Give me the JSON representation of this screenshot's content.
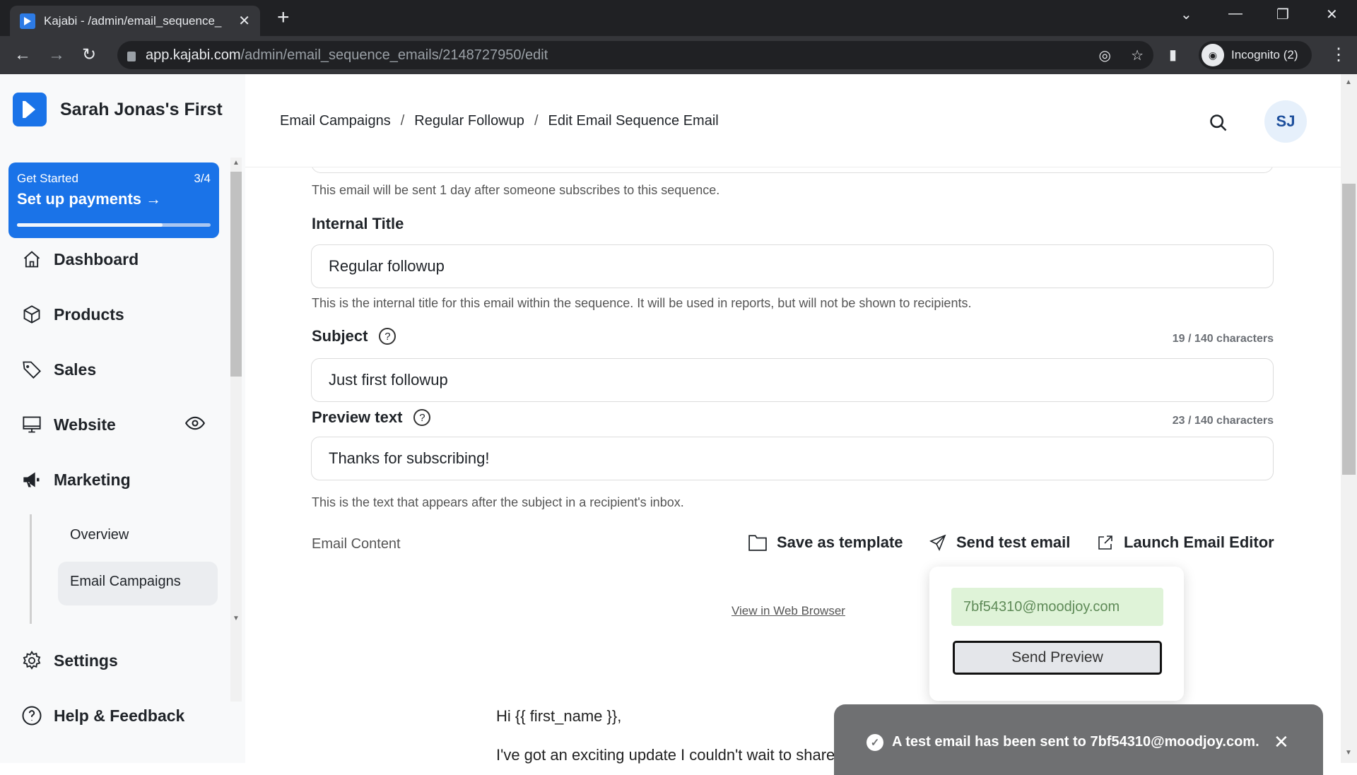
{
  "browser": {
    "tab_title": "Kajabi - /admin/email_sequence_",
    "url_host": "app.kajabi.com",
    "url_path": "/admin/email_sequence_emails/2148727950/edit",
    "profile_label": "Incognito (2)",
    "icons": [
      "back-icon",
      "forward-icon",
      "reload-icon",
      "lock-icon",
      "eye-off-icon",
      "star-icon",
      "sidepanel-icon",
      "incognito-icon",
      "menu-icon"
    ]
  },
  "sidebar": {
    "site_name": "Sarah Jonas's First",
    "get_started": {
      "label": "Get Started",
      "step": "3/4",
      "action": "Set up payments",
      "progress": 0.75
    },
    "items": [
      {
        "label": "Dashboard",
        "icon": "home-icon"
      },
      {
        "label": "Products",
        "icon": "box-icon"
      },
      {
        "label": "Sales",
        "icon": "tag-icon"
      },
      {
        "label": "Website",
        "icon": "monitor-icon"
      },
      {
        "label": "Marketing",
        "icon": "megaphone-icon"
      },
      {
        "label": "Settings",
        "icon": "gear-icon"
      },
      {
        "label": "Help & Feedback",
        "icon": "help-icon"
      }
    ],
    "sub_items": [
      {
        "label": "Overview"
      },
      {
        "label": "Email Campaigns",
        "active": true
      }
    ]
  },
  "header": {
    "breadcrumbs": [
      "Email Campaigns",
      "Regular Followup",
      "Edit Email Sequence Email"
    ],
    "avatar_initials": "SJ"
  },
  "form": {
    "schedule_help": "This email will be sent 1 day after someone subscribes to this sequence.",
    "internal_title": {
      "label": "Internal Title",
      "value": "Regular followup",
      "help": "This is the internal title for this email within the sequence. It will be used in reports, but will not be shown to recipients."
    },
    "subject": {
      "label": "Subject",
      "value": "Just first followup",
      "count": "19 / 140 characters"
    },
    "preview_text": {
      "label": "Preview text",
      "value": "Thanks for subscribing!",
      "count": "23 / 140 characters",
      "help": "This is the text that appears after the subject in a recipient's inbox."
    },
    "email_content_label": "Email Content",
    "actions": {
      "save_template": "Save as template",
      "send_test": "Send test email",
      "launch_editor": "Launch Email Editor"
    }
  },
  "email_preview": {
    "view_in_browser": "View in Web Browser",
    "greeting": "Hi {{ first_name }},",
    "body": "I've got an exciting update I couldn't wait to share with you. In fact, it could"
  },
  "test_popover": {
    "email": "7bf54310@moodjoy.com",
    "button": "Send Preview"
  },
  "toast": {
    "message": "A test email has been sent to 7bf54310@moodjoy.com."
  }
}
